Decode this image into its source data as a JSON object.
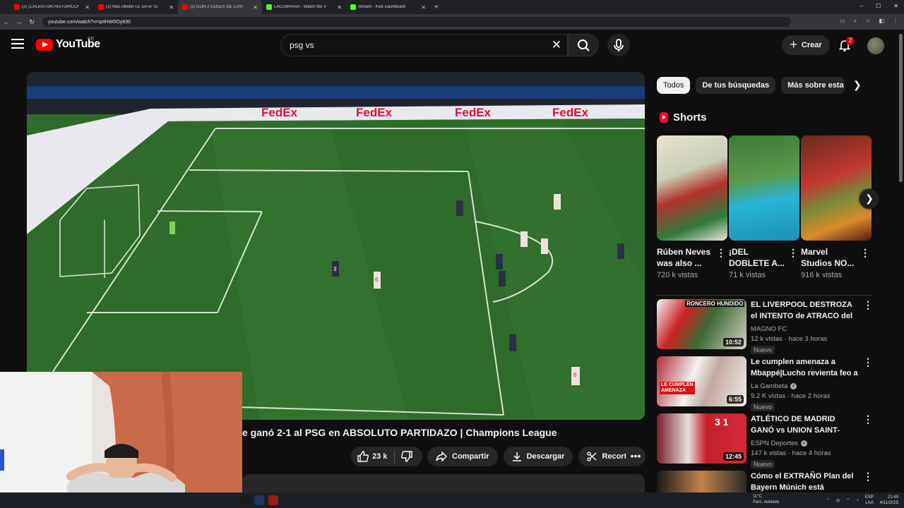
{
  "browser": {
    "tabs": [
      {
        "title": "(2) ¡CALENTÓN HISTÓRICO!",
        "favicon": "youtube",
        "active": false
      },
      {
        "title": "(2) Mac Allister LE DA el TE",
        "favicon": "youtube",
        "active": false
      },
      {
        "title": "(2) CON 2 GOLES DE LUIS",
        "favicon": "youtube",
        "active": true
      },
      {
        "title": "LACOBRAAA - Watch the V",
        "favicon": "kick",
        "active": false
      },
      {
        "title": "Stream - Kick Dashboard",
        "favicon": "kick",
        "active": false
      }
    ],
    "new_tab": "+",
    "url": "youtube.com/watch?v=qvlHW0Oy830",
    "window_controls": {
      "minimize": "–",
      "maximize": "☐",
      "close": "✕"
    }
  },
  "header": {
    "logo_text": "YouTube",
    "country_code": "PE",
    "search_value": "psg vs",
    "create_label": "Crear",
    "notifications_count": "2"
  },
  "video": {
    "title_visible": "e ganó 2-1 al PSG en ABSOLUTO PARTIDAZO | Champions League",
    "likes": "23 k",
    "share_label": "Compartir",
    "download_label": "Descargar",
    "clip_label": "Recortar",
    "ad_boards": [
      "FedEx",
      "FedEx",
      "FedEx",
      "FedEx"
    ],
    "player_numbers": [
      "3",
      "6",
      "6"
    ]
  },
  "sidebar": {
    "chips": [
      "Todos",
      "De tus búsquedas",
      "Más sobre esta not"
    ],
    "shorts_heading": "Shorts",
    "shorts": [
      {
        "title": "Rúben Neves was also ...",
        "views": "720 k vistas"
      },
      {
        "title": "¡DEL DOBLETE A...",
        "views": "71 k vistas"
      },
      {
        "title": "Marvel Studios NO...",
        "views": "916 k vistas"
      }
    ],
    "videos": [
      {
        "title": "EL LIVERPOOL DESTROZA el INTENTO de ATRACO del ...",
        "channel": "MAGNO FC",
        "verified": false,
        "meta": "12 k vistas · hace 3 horas",
        "duration": "10:52",
        "badge": "Nuevo",
        "thumb_text": "RONCERO HUNDIDO"
      },
      {
        "title": "Le cumplen amenaza a Mbappé|Lucho revienta feo a ...",
        "channel": "La Gambeta",
        "verified": true,
        "meta": "9.2 K vistas · hace 2 horas",
        "duration": "6:55",
        "badge": "Nuevo",
        "thumb_text": "LE CUMPLEN AMENAZA"
      },
      {
        "title": "ATLÉTICO DE MADRID GANÓ vs UNION SAINT-GILLOISE. GOL ...",
        "channel": "ESPN Deportes",
        "verified": true,
        "meta": "147 k vistas · hace 4 horas",
        "duration": "12:45",
        "badge": "Nuevo",
        "thumb_text": "3 1"
      },
      {
        "title": "Cómo el EXTRAÑO Plan del Bayern Múnich está Rompiend...",
        "channel": "",
        "verified": false,
        "meta": "",
        "duration": "",
        "badge": "",
        "thumb_text": ""
      }
    ]
  },
  "taskbar": {
    "weather_temp": "11°C",
    "weather_desc": "Parc. nublado",
    "lang": "ESP",
    "lang2": "LAA",
    "time": "21:49",
    "date": "4/11/2025"
  },
  "colors": {
    "bg": "#0f0f0f",
    "yt_red": "#ff0000",
    "chip_bg": "#272727",
    "pitch": "#2f6b2a"
  }
}
